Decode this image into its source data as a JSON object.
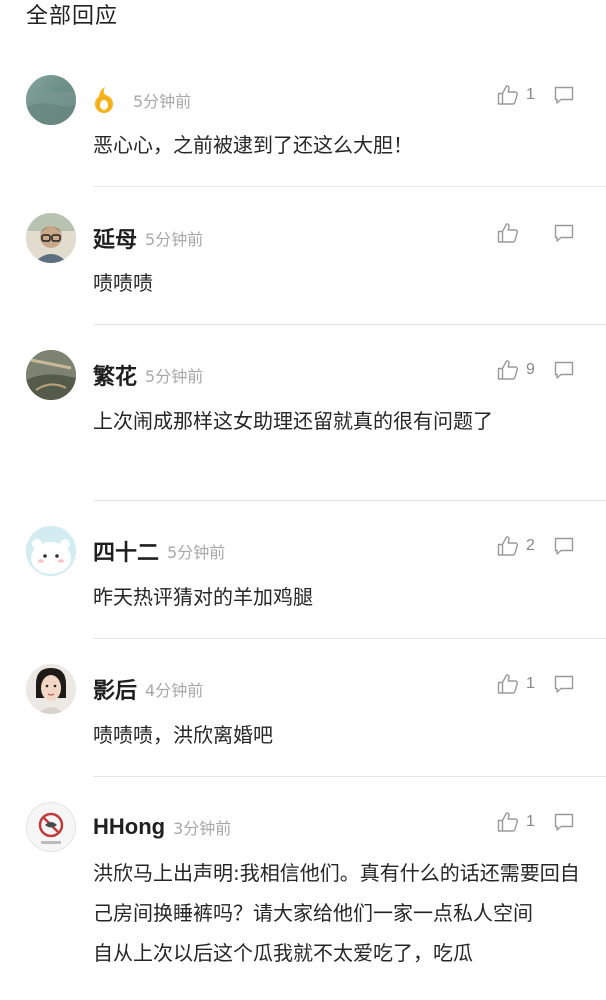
{
  "header": {
    "title": "全部回应"
  },
  "comments": [
    {
      "username": "",
      "badge_icon": "flame-icon",
      "timestamp": "5分钟前",
      "likes": "1",
      "text": "恶心心，之前被逮到了还这么大胆！"
    },
    {
      "username": "延母",
      "timestamp": "5分钟前",
      "likes": "",
      "text": "啧啧啧"
    },
    {
      "username": "繁花",
      "timestamp": "5分钟前",
      "likes": "9",
      "text": "上次闹成那样这女助理还留就真的很有问题了"
    },
    {
      "username": "四十二",
      "timestamp": "5分钟前",
      "likes": "2",
      "text": "昨天热评猜对的羊加鸡腿"
    },
    {
      "username": "影后",
      "timestamp": "4分钟前",
      "likes": "1",
      "text": "啧啧啧，洪欣离婚吧"
    },
    {
      "username": "HHong",
      "timestamp": "3分钟前",
      "likes": "1",
      "text": "洪欣马上出声明:我相信他们。真有什么的话还需要回自己房间换睡裤吗？请大家给他们一家一点私人空间\n自从上次以后这个瓜我就不太爱吃了，吃瓜"
    }
  ]
}
